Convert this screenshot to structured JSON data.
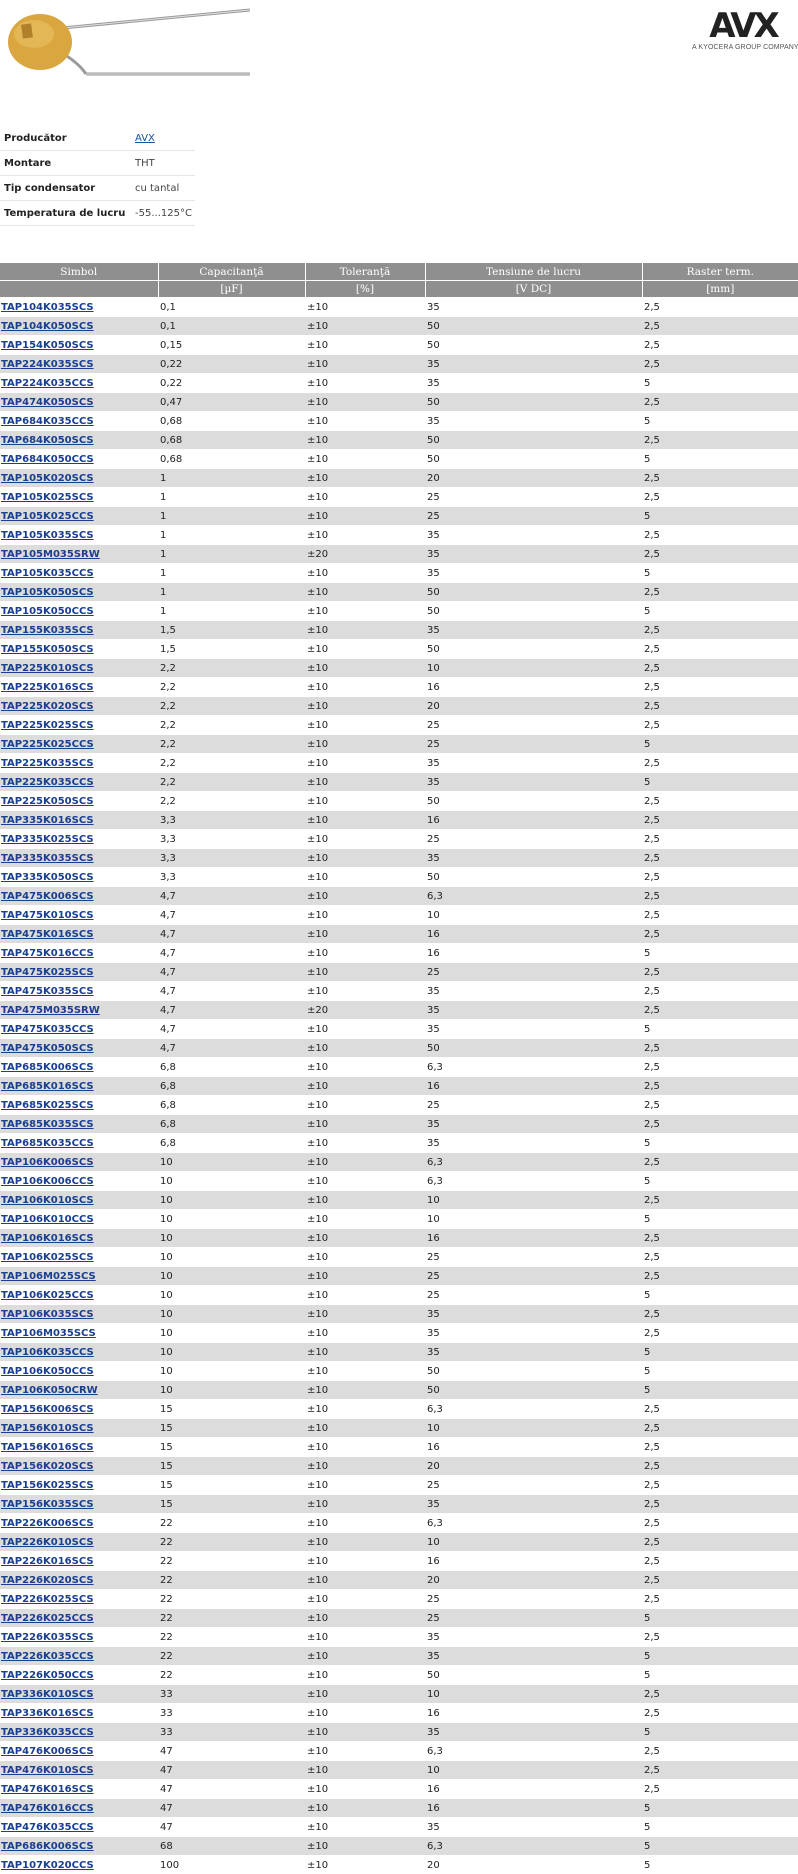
{
  "brand": {
    "logo": "AVX",
    "tagline": "A KYOCERA GROUP COMPANY"
  },
  "specs": [
    {
      "label": "Producător",
      "value": "AVX",
      "link": true
    },
    {
      "label": "Montare",
      "value": "THT",
      "link": false
    },
    {
      "label": "Tip condensator",
      "value": "cu tantal",
      "link": false
    },
    {
      "label": "Temperatura de lucru",
      "value": "-55...125°C",
      "link": false
    }
  ],
  "table": {
    "headers": [
      "Simbol",
      "Capacitanţă",
      "Toleranţă",
      "Tensiune de lucru",
      "Raster term."
    ],
    "units": [
      "",
      "[µF]",
      "[%]",
      "[V DC]",
      "[mm]"
    ],
    "rows": [
      [
        "TAP104K035SCS",
        "0,1",
        "±10",
        "35",
        "2,5"
      ],
      [
        "TAP104K050SCS",
        "0,1",
        "±10",
        "50",
        "2,5"
      ],
      [
        "TAP154K050SCS",
        "0,15",
        "±10",
        "50",
        "2,5"
      ],
      [
        "TAP224K035SCS",
        "0,22",
        "±10",
        "35",
        "2,5"
      ],
      [
        "TAP224K035CCS",
        "0,22",
        "±10",
        "35",
        "5"
      ],
      [
        "TAP474K050SCS",
        "0,47",
        "±10",
        "50",
        "2,5"
      ],
      [
        "TAP684K035CCS",
        "0,68",
        "±10",
        "35",
        "5"
      ],
      [
        "TAP684K050SCS",
        "0,68",
        "±10",
        "50",
        "2,5"
      ],
      [
        "TAP684K050CCS",
        "0,68",
        "±10",
        "50",
        "5"
      ],
      [
        "TAP105K020SCS",
        "1",
        "±10",
        "20",
        "2,5"
      ],
      [
        "TAP105K025SCS",
        "1",
        "±10",
        "25",
        "2,5"
      ],
      [
        "TAP105K025CCS",
        "1",
        "±10",
        "25",
        "5"
      ],
      [
        "TAP105K035SCS",
        "1",
        "±10",
        "35",
        "2,5"
      ],
      [
        "TAP105M035SRW",
        "1",
        "±20",
        "35",
        "2,5"
      ],
      [
        "TAP105K035CCS",
        "1",
        "±10",
        "35",
        "5"
      ],
      [
        "TAP105K050SCS",
        "1",
        "±10",
        "50",
        "2,5"
      ],
      [
        "TAP105K050CCS",
        "1",
        "±10",
        "50",
        "5"
      ],
      [
        "TAP155K035SCS",
        "1,5",
        "±10",
        "35",
        "2,5"
      ],
      [
        "TAP155K050SCS",
        "1,5",
        "±10",
        "50",
        "2,5"
      ],
      [
        "TAP225K010SCS",
        "2,2",
        "±10",
        "10",
        "2,5"
      ],
      [
        "TAP225K016SCS",
        "2,2",
        "±10",
        "16",
        "2,5"
      ],
      [
        "TAP225K020SCS",
        "2,2",
        "±10",
        "20",
        "2,5"
      ],
      [
        "TAP225K025SCS",
        "2,2",
        "±10",
        "25",
        "2,5"
      ],
      [
        "TAP225K025CCS",
        "2,2",
        "±10",
        "25",
        "5"
      ],
      [
        "TAP225K035SCS",
        "2,2",
        "±10",
        "35",
        "2,5"
      ],
      [
        "TAP225K035CCS",
        "2,2",
        "±10",
        "35",
        "5"
      ],
      [
        "TAP225K050SCS",
        "2,2",
        "±10",
        "50",
        "2,5"
      ],
      [
        "TAP335K016SCS",
        "3,3",
        "±10",
        "16",
        "2,5"
      ],
      [
        "TAP335K025SCS",
        "3,3",
        "±10",
        "25",
        "2,5"
      ],
      [
        "TAP335K035SCS",
        "3,3",
        "±10",
        "35",
        "2,5"
      ],
      [
        "TAP335K050SCS",
        "3,3",
        "±10",
        "50",
        "2,5"
      ],
      [
        "TAP475K006SCS",
        "4,7",
        "±10",
        "6,3",
        "2,5"
      ],
      [
        "TAP475K010SCS",
        "4,7",
        "±10",
        "10",
        "2,5"
      ],
      [
        "TAP475K016SCS",
        "4,7",
        "±10",
        "16",
        "2,5"
      ],
      [
        "TAP475K016CCS",
        "4,7",
        "±10",
        "16",
        "5"
      ],
      [
        "TAP475K025SCS",
        "4,7",
        "±10",
        "25",
        "2,5"
      ],
      [
        "TAP475K035SCS",
        "4,7",
        "±10",
        "35",
        "2,5"
      ],
      [
        "TAP475M035SRW",
        "4,7",
        "±20",
        "35",
        "2,5"
      ],
      [
        "TAP475K035CCS",
        "4,7",
        "±10",
        "35",
        "5"
      ],
      [
        "TAP475K050SCS",
        "4,7",
        "±10",
        "50",
        "2,5"
      ],
      [
        "TAP685K006SCS",
        "6,8",
        "±10",
        "6,3",
        "2,5"
      ],
      [
        "TAP685K016SCS",
        "6,8",
        "±10",
        "16",
        "2,5"
      ],
      [
        "TAP685K025SCS",
        "6,8",
        "±10",
        "25",
        "2,5"
      ],
      [
        "TAP685K035SCS",
        "6,8",
        "±10",
        "35",
        "2,5"
      ],
      [
        "TAP685K035CCS",
        "6,8",
        "±10",
        "35",
        "5"
      ],
      [
        "TAP106K006SCS",
        "10",
        "±10",
        "6,3",
        "2,5"
      ],
      [
        "TAP106K006CCS",
        "10",
        "±10",
        "6,3",
        "5"
      ],
      [
        "TAP106K010SCS",
        "10",
        "±10",
        "10",
        "2,5"
      ],
      [
        "TAP106K010CCS",
        "10",
        "±10",
        "10",
        "5"
      ],
      [
        "TAP106K016SCS",
        "10",
        "±10",
        "16",
        "2,5"
      ],
      [
        "TAP106K025SCS",
        "10",
        "±10",
        "25",
        "2,5"
      ],
      [
        "TAP106M025SCS",
        "10",
        "±10",
        "25",
        "2,5"
      ],
      [
        "TAP106K025CCS",
        "10",
        "±10",
        "25",
        "5"
      ],
      [
        "TAP106K035SCS",
        "10",
        "±10",
        "35",
        "2,5"
      ],
      [
        "TAP106M035SCS",
        "10",
        "±10",
        "35",
        "2,5"
      ],
      [
        "TAP106K035CCS",
        "10",
        "±10",
        "35",
        "5"
      ],
      [
        "TAP106K050CCS",
        "10",
        "±10",
        "50",
        "5"
      ],
      [
        "TAP106K050CRW",
        "10",
        "±10",
        "50",
        "5"
      ],
      [
        "TAP156K006SCS",
        "15",
        "±10",
        "6,3",
        "2,5"
      ],
      [
        "TAP156K010SCS",
        "15",
        "±10",
        "10",
        "2,5"
      ],
      [
        "TAP156K016SCS",
        "15",
        "±10",
        "16",
        "2,5"
      ],
      [
        "TAP156K020SCS",
        "15",
        "±10",
        "20",
        "2,5"
      ],
      [
        "TAP156K025SCS",
        "15",
        "±10",
        "25",
        "2,5"
      ],
      [
        "TAP156K035SCS",
        "15",
        "±10",
        "35",
        "2,5"
      ],
      [
        "TAP226K006SCS",
        "22",
        "±10",
        "6,3",
        "2,5"
      ],
      [
        "TAP226K010SCS",
        "22",
        "±10",
        "10",
        "2,5"
      ],
      [
        "TAP226K016SCS",
        "22",
        "±10",
        "16",
        "2,5"
      ],
      [
        "TAP226K020SCS",
        "22",
        "±10",
        "20",
        "2,5"
      ],
      [
        "TAP226K025SCS",
        "22",
        "±10",
        "25",
        "2,5"
      ],
      [
        "TAP226K025CCS",
        "22",
        "±10",
        "25",
        "5"
      ],
      [
        "TAP226K035SCS",
        "22",
        "±10",
        "35",
        "2,5"
      ],
      [
        "TAP226K035CCS",
        "22",
        "±10",
        "35",
        "5"
      ],
      [
        "TAP226K050CCS",
        "22",
        "±10",
        "50",
        "5"
      ],
      [
        "TAP336K010SCS",
        "33",
        "±10",
        "10",
        "2,5"
      ],
      [
        "TAP336K016SCS",
        "33",
        "±10",
        "16",
        "2,5"
      ],
      [
        "TAP336K035CCS",
        "33",
        "±10",
        "35",
        "5"
      ],
      [
        "TAP476K006SCS",
        "47",
        "±10",
        "6,3",
        "2,5"
      ],
      [
        "TAP476K010SCS",
        "47",
        "±10",
        "10",
        "2,5"
      ],
      [
        "TAP476K016SCS",
        "47",
        "±10",
        "16",
        "2,5"
      ],
      [
        "TAP476K016CCS",
        "47",
        "±10",
        "16",
        "5"
      ],
      [
        "TAP476K035CCS",
        "47",
        "±10",
        "35",
        "5"
      ],
      [
        "TAP686K006SCS",
        "68",
        "±10",
        "6,3",
        "5"
      ],
      [
        "TAP107K020CCS",
        "100",
        "±10",
        "20",
        "5"
      ]
    ]
  }
}
